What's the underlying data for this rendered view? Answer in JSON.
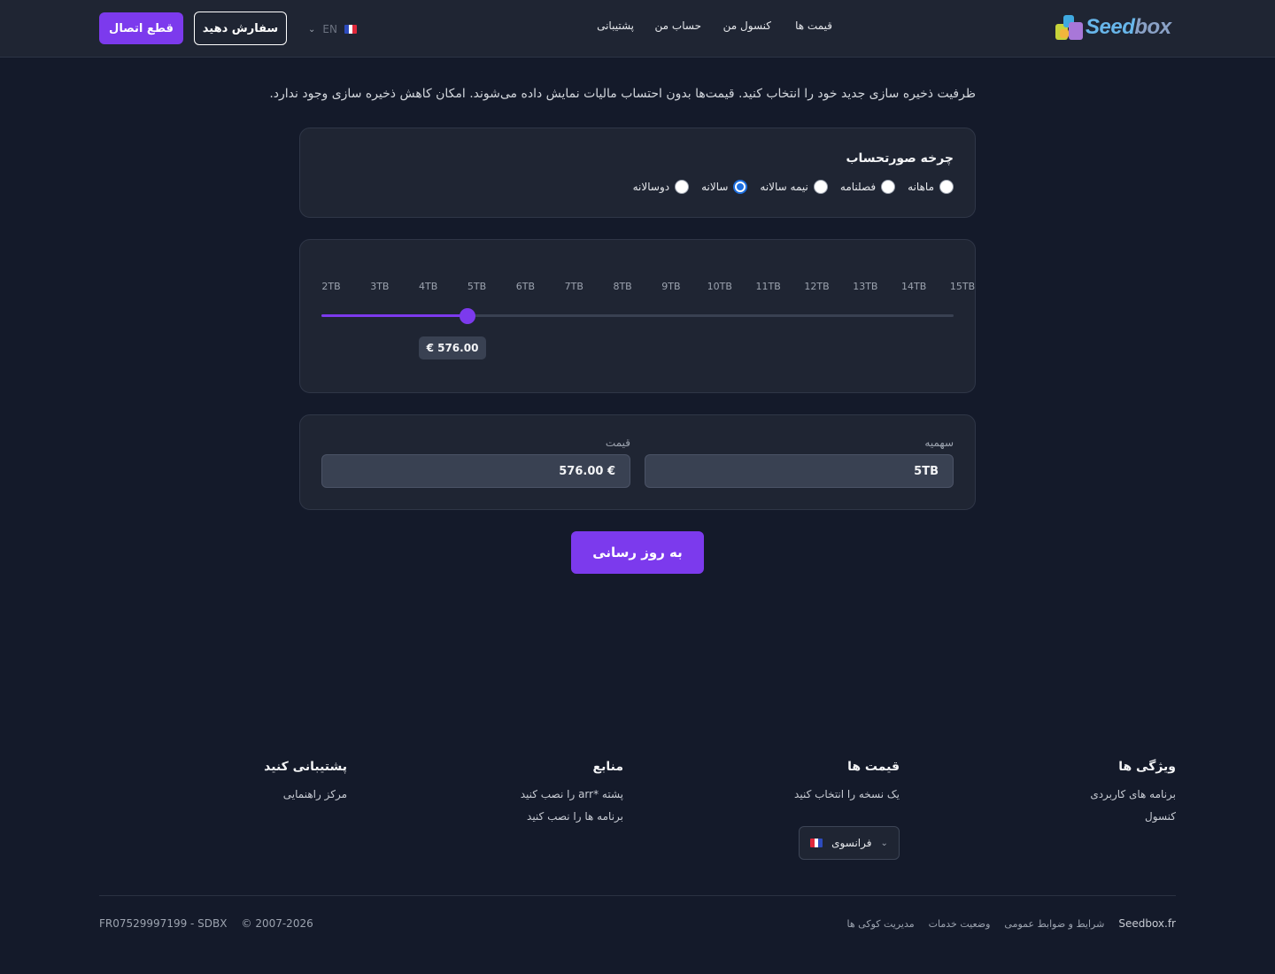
{
  "header": {
    "logo_text_a": "Seed",
    "logo_text_b": "box",
    "nav": [
      "قیمت ها",
      "کنسول من",
      "حساب من",
      "پشتیبانی"
    ],
    "lang_code": "EN",
    "order_label": "سفارش دهید",
    "logout_label": "قطع اتصال"
  },
  "intro": "ظرفیت ذخیره سازی جدید خود را انتخاب کنید. قیمت‌ها بدون احتساب مالیات نمایش داده می‌شوند. امکان کاهش ذخیره سازی وجود ندارد.",
  "billing": {
    "title": "چرخه صورتحساب",
    "options": [
      "ماهانه",
      "فصلنامه",
      "نیمه سالانه",
      "سالانه",
      "دوسالانه"
    ],
    "selected_index": 3
  },
  "slider": {
    "ticks": [
      "2TB",
      "3TB",
      "4TB",
      "5TB",
      "6TB",
      "7TB",
      "8TB",
      "9TB",
      "10TB",
      "11TB",
      "12TB",
      "13TB",
      "14TB",
      "15TB"
    ],
    "selected_index": 3,
    "price_label": "€ 576.00"
  },
  "summary": {
    "quota_label": "سهمیه",
    "quota_value": "5TB",
    "price_label": "قیمت",
    "price_value": "€ 576.00"
  },
  "update_label": "به روز رسانی",
  "footer": {
    "features": {
      "title": "ویژگی ها",
      "links": [
        "برنامه های کاربردی",
        "کنسول"
      ]
    },
    "pricing": {
      "title": "قیمت ها",
      "links": [
        "یک نسخه را انتخاب کنید"
      ]
    },
    "resources": {
      "title": "منابع",
      "links": [
        "پشته *arr را نصب کنید",
        "برنامه ها را نصب کنید"
      ]
    },
    "support": {
      "title": "پشتیبانی کنید",
      "links": [
        "مرکز راهنمایی"
      ]
    },
    "language_select": "فرانسوی",
    "bottom_links": [
      "Seedbox.fr",
      "شرایط و ضوابط عمومی",
      "وضعیت خدمات",
      "مدیریت کوکی ها"
    ],
    "copyright": "© 2007-2026",
    "registration": "FR07529997199 - SDBX"
  },
  "colors": {
    "accent": "#7c3aed",
    "background": "#141a2a",
    "card": "#1f2533",
    "radio_checked": "#1d6fe0"
  }
}
